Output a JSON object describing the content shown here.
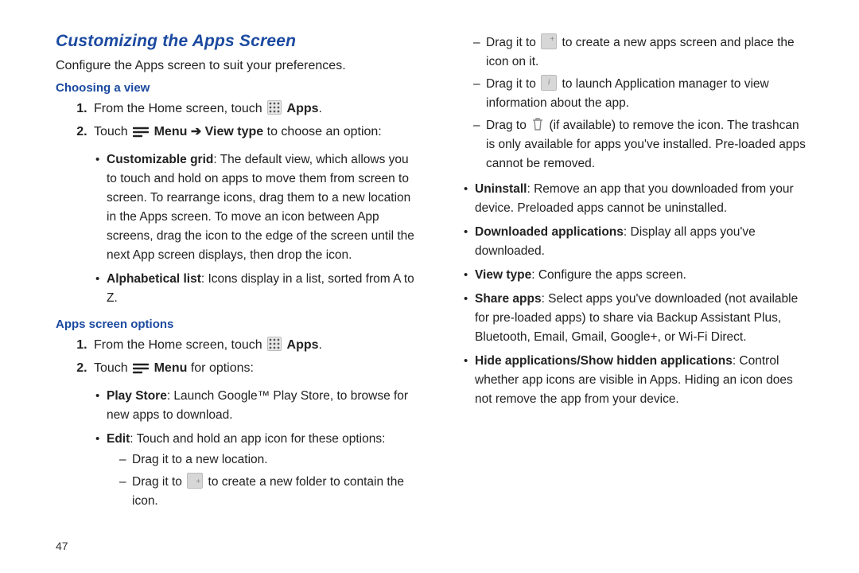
{
  "page_number": "47",
  "section_title": "Customizing the Apps Screen",
  "intro": "Configure the Apps screen to suit your preferences.",
  "subhead_choosing": "Choosing a view",
  "choosing": {
    "step1_a": "From the Home screen, touch ",
    "step1_b": " Apps",
    "step1_c": ".",
    "step2_a": "Touch ",
    "step2_b": " Menu ➔ View type",
    "step2_c": " to choose an option:",
    "bullet1_label": "Customizable grid",
    "bullet1_text": ": The default view, which allows you to touch and hold on apps to move them from screen to screen. To rearrange icons, drag them to a new location in the Apps screen. To move an icon between App screens, drag the icon to the edge of the screen until the next App screen displays, then drop the icon.",
    "bullet2_label": "Alphabetical list",
    "bullet2_text": ": Icons display in a list, sorted from A to Z."
  },
  "subhead_options": "Apps screen options",
  "options": {
    "step1_a": "From the Home screen, touch ",
    "step1_b": " Apps",
    "step1_c": ".",
    "step2_a": "Touch ",
    "step2_b": " Menu",
    "step2_c": " for options:",
    "playstore_label": "Play Store",
    "playstore_text": ": Launch Google™ Play Store, to browse for new apps to download.",
    "edit_label": "Edit",
    "edit_text": ": Touch and hold an app icon for these options:",
    "edit_d1": "Drag it to a new location.",
    "edit_d2_a": "Drag it to ",
    "edit_d2_b": " to create a new folder to contain the icon.",
    "edit_d3_a": "Drag it to ",
    "edit_d3_b": " to create a new apps screen and place the icon on it.",
    "edit_d4_a": "Drag it to ",
    "edit_d4_b": " to launch Application manager to view information about the app.",
    "edit_d5_a": "Drag to ",
    "edit_d5_b": " (if available) to remove the icon. The trashcan is only available for apps you've installed. Pre-loaded apps cannot be removed.",
    "uninstall_label": "Uninstall",
    "uninstall_text": ": Remove an app that you downloaded from your device. Preloaded apps cannot be uninstalled.",
    "downloaded_label": "Downloaded applications",
    "downloaded_text": ": Display all apps you've downloaded.",
    "viewtype_label": "View type",
    "viewtype_text": ": Configure the apps screen.",
    "share_label": "Share apps",
    "share_text": ": Select apps you've downloaded (not available for pre-loaded apps) to share via Backup Assistant Plus, Bluetooth, Email, Gmail, Google+, or Wi-Fi Direct.",
    "hide_label": "Hide applications/Show hidden applications",
    "hide_text": ": Control whether app icons are visible in Apps. Hiding an icon does not remove the app from your device."
  }
}
